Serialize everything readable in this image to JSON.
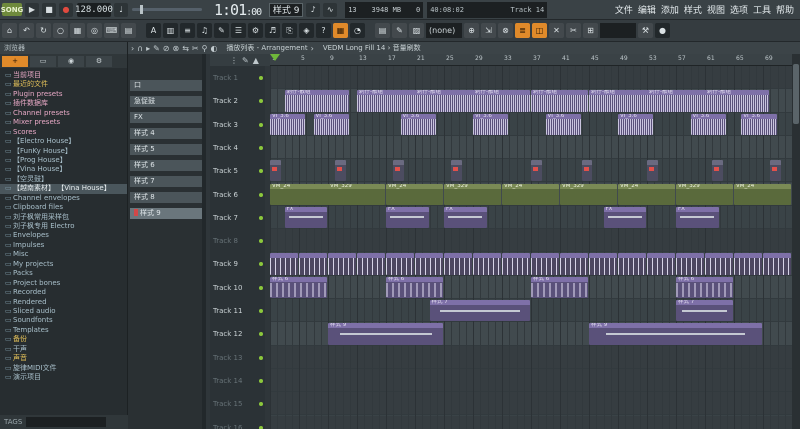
{
  "topbar": {
    "song_badge": "SONG",
    "tempo": "128.000",
    "time": "1:01",
    "time_sub": ":00",
    "pattern": "样式 9",
    "cpu": "13",
    "ram": "3948 MB",
    "cpu_extra": "0",
    "hint_time": "40:08:02",
    "hint_track": "Track 14",
    "menus": [
      "文件",
      "编辑",
      "添加",
      "样式",
      "视图",
      "选项",
      "工具",
      "帮助"
    ]
  },
  "toolbar2": {
    "snap_label": "(none)"
  },
  "browser": {
    "title": "浏览器",
    "items": [
      {
        "label": "当前项目",
        "style": "pink"
      },
      {
        "label": "最近的文件",
        "style": "yellow"
      },
      {
        "label": "Plugin presets",
        "style": "pink"
      },
      {
        "label": "插件数据库",
        "style": "pink"
      },
      {
        "label": "Channel presets",
        "style": "pink"
      },
      {
        "label": "Mixer presets",
        "style": "pink"
      },
      {
        "label": "Scores",
        "style": "pink"
      },
      {
        "label": "【Electro House】",
        "style": "normal"
      },
      {
        "label": "【FunKy House】",
        "style": "normal"
      },
      {
        "label": "【Prog House】",
        "style": "normal"
      },
      {
        "label": "【Vina House】",
        "style": "normal"
      },
      {
        "label": "【空灵鼓】",
        "style": "normal"
      },
      {
        "label": "【越南素材】 【Vina House】",
        "style": "selected"
      },
      {
        "label": "Channel envelopes",
        "style": "normal"
      },
      {
        "label": "Clipboard files",
        "style": "normal"
      },
      {
        "label": "刘子枫常用采样包",
        "style": "normal"
      },
      {
        "label": "刘子枫专用 Electro",
        "style": "normal"
      },
      {
        "label": "Envelopes",
        "style": "normal"
      },
      {
        "label": "Impulses",
        "style": "normal"
      },
      {
        "label": "Misc",
        "style": "normal"
      },
      {
        "label": "My projects",
        "style": "normal"
      },
      {
        "label": "Packs",
        "style": "normal"
      },
      {
        "label": "Project bones",
        "style": "normal"
      },
      {
        "label": "Recorded",
        "style": "normal"
      },
      {
        "label": "Rendered",
        "style": "normal"
      },
      {
        "label": "Sliced audio",
        "style": "normal"
      },
      {
        "label": "Soundfonts",
        "style": "normal"
      },
      {
        "label": "Templates",
        "style": "normal"
      },
      {
        "label": "备份",
        "style": "yellow"
      },
      {
        "label": "干声",
        "style": "normal"
      },
      {
        "label": "声音",
        "style": "yellow"
      },
      {
        "label": "旋律MIDI文件",
        "style": "normal"
      },
      {
        "label": "演示项目",
        "style": "normal"
      }
    ],
    "tags_label": "TAGS"
  },
  "playlist": {
    "title_prefix": "播放列表 - Arrangement",
    "breadcrumb": "VEDM Long Fill 14 › 音量刷数",
    "patterns": [
      "口",
      "急促鼓",
      "FX",
      "样式 4",
      "样式 5",
      "样式 6",
      "样式 7",
      "样式 8",
      "样式 9"
    ],
    "bar_numbers": [
      "1",
      "5",
      "9",
      "13",
      "17",
      "21",
      "25",
      "29",
      "33",
      "37",
      "41",
      "45",
      "49",
      "53",
      "57",
      "61",
      "65",
      "69"
    ],
    "tracks": [
      {
        "label": "Track 1",
        "dim": true
      },
      {
        "label": "Track 2",
        "dim": false
      },
      {
        "label": "Track 3",
        "dim": false
      },
      {
        "label": "Track 4",
        "dim": false
      },
      {
        "label": "Track 5",
        "dim": false
      },
      {
        "label": "Track 6",
        "dim": false
      },
      {
        "label": "Track 7",
        "dim": false
      },
      {
        "label": "Track 8",
        "dim": true
      },
      {
        "label": "Track 9",
        "dim": false
      },
      {
        "label": "Track 10",
        "dim": false
      },
      {
        "label": "Track 11",
        "dim": false
      },
      {
        "label": "Track 12",
        "dim": false
      },
      {
        "label": "Track 13",
        "dim": true
      },
      {
        "label": "Track 14",
        "dim": true
      },
      {
        "label": "Track 15",
        "dim": true
      },
      {
        "label": "Track 16",
        "dim": true
      }
    ],
    "clip_labels": {
      "track2": "刺仔-散组",
      "track3": "VI_3.6",
      "track6": "VM_24",
      "track6b": "VM_329",
      "fx": "FX",
      "pat6": "样式 6",
      "pat7": "样式 7",
      "pat9": "样式 9"
    }
  },
  "colors": {
    "accent_orange": "#e08a2a",
    "clip_purple": "#7e70a8",
    "clip_green": "#7a8a55",
    "led_green": "#8cc83c",
    "record_red": "#e04a3f"
  }
}
